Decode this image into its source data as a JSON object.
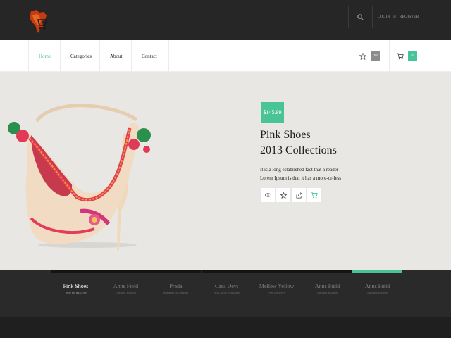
{
  "header": {
    "logo_icon": "shopping-cart-map-logo",
    "search_icon": "search-icon",
    "login_label": "LOGIN",
    "or_label": "or",
    "register_label": "REGISTER"
  },
  "nav": {
    "items": [
      {
        "label": "Home"
      },
      {
        "label": "Categories"
      },
      {
        "label": "About"
      },
      {
        "label": "Contact"
      }
    ],
    "wishlist_count": "30",
    "cart_count": "0"
  },
  "hero": {
    "price": "$145.99",
    "title_line1": "Pink Shoes",
    "title_line2": "2013 Collections",
    "desc_line1": "It is a long established fact that a reader",
    "desc_line2": "Lorem Ipsum is that it has a more-or-less"
  },
  "thumbs": [
    {
      "name": "Pink Shoes",
      "sub": "New Of $145.99"
    },
    {
      "name": "Anns Field",
      "sub": "Limited Edition"
    },
    {
      "name": "Prada",
      "sub": "Summer Is Coming"
    },
    {
      "name": "Casa Devi",
      "sub": "All Colors Available"
    },
    {
      "name": "Mellow Yellow",
      "sub": "Free Delivery"
    },
    {
      "name": "Anns Field",
      "sub": "Limited Edition"
    },
    {
      "name": "Anns Field",
      "sub": "Limited Edition"
    }
  ],
  "colors": {
    "accent": "#47c39a",
    "topbar": "#262626",
    "hero_bg": "#e8e7e3"
  }
}
